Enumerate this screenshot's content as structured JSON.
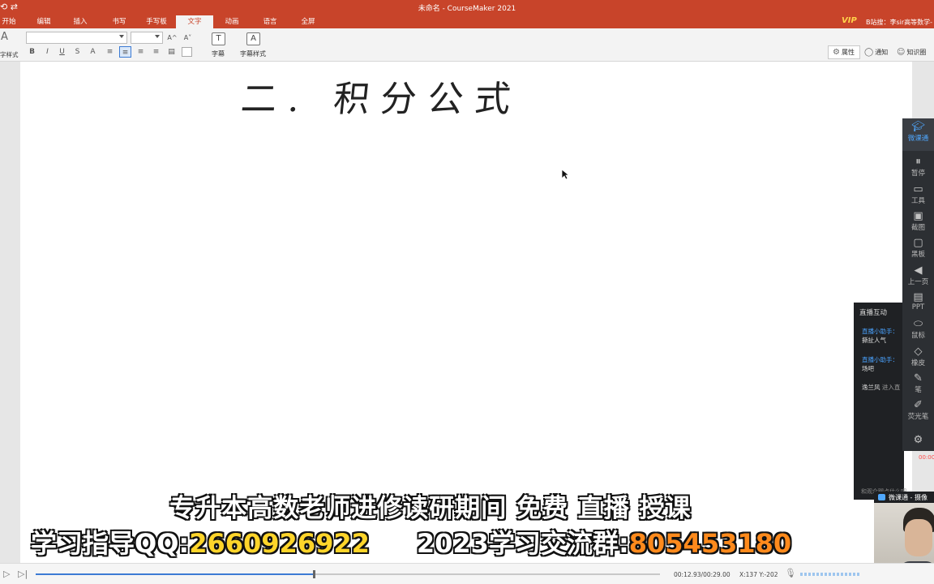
{
  "window": {
    "title": "未命名 - CourseMaker 2021",
    "quick_access": "⟲ ⇄"
  },
  "ribbon_tabs": [
    {
      "label": "开始"
    },
    {
      "label": "编辑"
    },
    {
      "label": "插入"
    },
    {
      "label": "书写"
    },
    {
      "label": "手写板"
    },
    {
      "label": "文字"
    },
    {
      "label": "动画"
    },
    {
      "label": "语言"
    },
    {
      "label": "全屏"
    }
  ],
  "active_tab": "文字",
  "account": {
    "vip": "VIP",
    "name": "B站搜：李sir高等数学-"
  },
  "ribbon": {
    "left_group_label": "字样式",
    "font_name": "",
    "font_size": "",
    "grow_font": "A^",
    "shrink_font": "A˅",
    "format_buttons": [
      "B",
      "I",
      "U",
      "S",
      "A"
    ],
    "subtitle_label": "字幕",
    "subtitle_style_label": "字幕样式",
    "properties_label": "属性",
    "notify_label": "通知",
    "knowledge_label": "知识圈"
  },
  "canvas": {
    "handwritten_text": "二. 积分公式"
  },
  "right_toolbar": {
    "brand": "微课通",
    "items": [
      {
        "label": "暂停",
        "icon": "pause-icon"
      },
      {
        "label": "工具",
        "icon": "toolbox-icon"
      },
      {
        "label": "截图",
        "icon": "screenshot-icon"
      },
      {
        "label": "黑板",
        "icon": "blackboard-icon"
      },
      {
        "label": "上一页",
        "icon": "arrow-left-icon"
      },
      {
        "label": "PPT",
        "icon": "ppt-icon"
      },
      {
        "label": "鼠标",
        "icon": "mouse-icon"
      },
      {
        "label": "橡皮",
        "icon": "eraser-icon"
      },
      {
        "label": "笔",
        "icon": "pen-icon"
      },
      {
        "label": "荧光笔",
        "icon": "highlighter-icon"
      }
    ],
    "timer": "00:00"
  },
  "live_panel": {
    "title": "直播互动",
    "messages": [
      {
        "sender": "直播小助手：",
        "text": "撕扯人气"
      },
      {
        "sender": "直播小助手：",
        "text": "场吧"
      },
      {
        "sender": "逸兰风",
        "text": "进入直"
      }
    ],
    "footer": "和观众聊点什么吧"
  },
  "webcam": {
    "label": "微课通 - 摄像"
  },
  "captions": {
    "line1": "专升本高数老师进修读研期间 免费 直播 授课",
    "line2_prefix": "学习指导QQ:",
    "line2_qq": "2660926922",
    "line2_group_label": "2023学习交流群:",
    "line2_group": "805453180"
  },
  "player": {
    "time": "00:12.93/00:29.00",
    "coords": "X:137 Y:-202",
    "progress": 0.446
  },
  "colors": {
    "brand": "#c8442a",
    "accent": "#3c7bd4",
    "caption_yellow": "#ffd52a",
    "caption_orange": "#ff8a1c"
  }
}
